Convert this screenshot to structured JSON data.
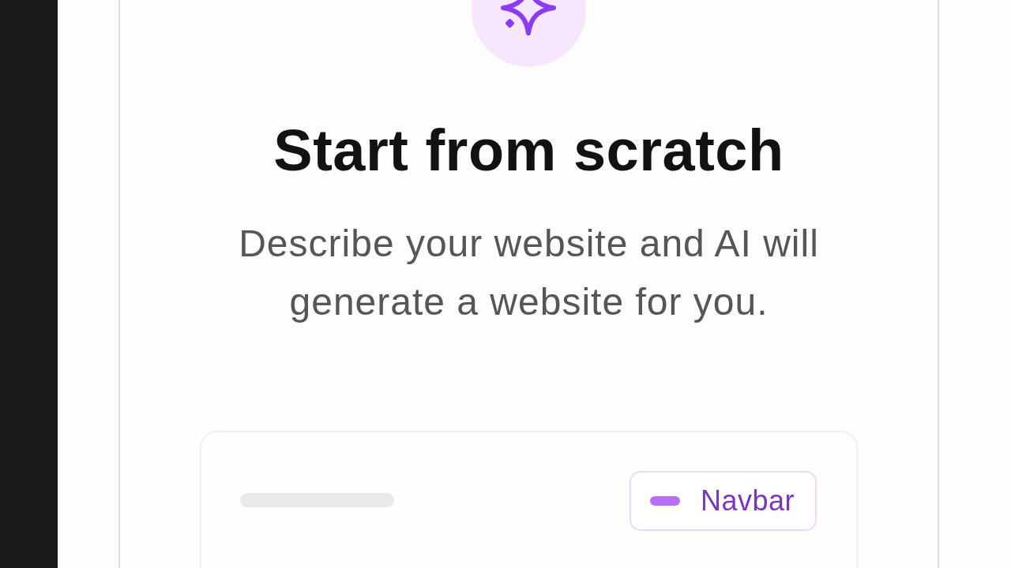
{
  "hero": {
    "title": "Start from scratch",
    "description": "Describe your website and AI will generate a website for you."
  },
  "preview": {
    "tag": {
      "label": "Navbar"
    }
  }
}
